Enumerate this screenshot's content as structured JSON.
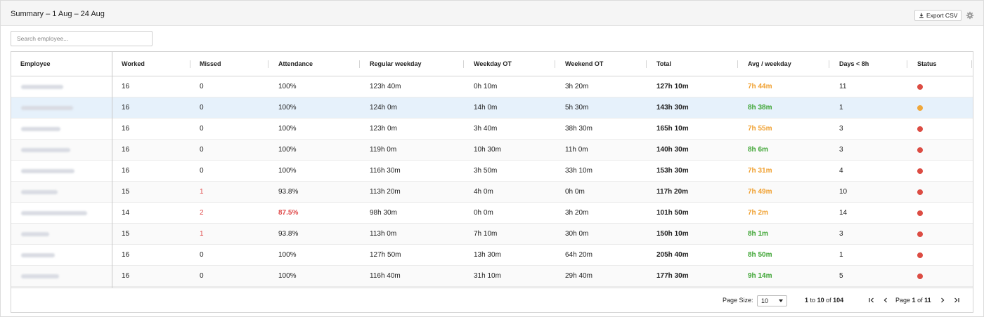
{
  "header": {
    "title": "Summary – 1 Aug – 24 Aug",
    "export_label": "Export CSV",
    "export_icon": "download-icon",
    "settings_icon": "gear-icon"
  },
  "search": {
    "placeholder": "Search employee...",
    "value": ""
  },
  "table": {
    "columns": [
      "Employee",
      "Worked",
      "Missed",
      "Attendance",
      "Regular weekday",
      "Weekday OT",
      "Weekend OT",
      "Total",
      "Avg / weekday",
      "Days < 8h",
      "Status"
    ],
    "rows": [
      {
        "worked": "16",
        "missed": "0",
        "attendance": "100%",
        "regular": "123h 40m",
        "weekday_ot": "0h 10m",
        "weekend_ot": "3h 20m",
        "total": "127h 10m",
        "avg": "7h 44m",
        "days_under": "11",
        "avg_tone": "warn",
        "status": "red"
      },
      {
        "worked": "16",
        "missed": "0",
        "attendance": "100%",
        "regular": "124h 0m",
        "weekday_ot": "14h 0m",
        "weekend_ot": "5h 30m",
        "total": "143h 30m",
        "avg": "8h 38m",
        "days_under": "1",
        "avg_tone": "ok",
        "status": "orange"
      },
      {
        "worked": "16",
        "missed": "0",
        "attendance": "100%",
        "regular": "123h 0m",
        "weekday_ot": "3h 40m",
        "weekend_ot": "38h 30m",
        "total": "165h 10m",
        "avg": "7h 55m",
        "days_under": "3",
        "avg_tone": "warn",
        "status": "red"
      },
      {
        "worked": "16",
        "missed": "0",
        "attendance": "100%",
        "regular": "119h 0m",
        "weekday_ot": "10h 30m",
        "weekend_ot": "11h 0m",
        "total": "140h 30m",
        "avg": "8h 6m",
        "days_under": "3",
        "avg_tone": "ok",
        "status": "red"
      },
      {
        "worked": "16",
        "missed": "0",
        "attendance": "100%",
        "regular": "116h 30m",
        "weekday_ot": "3h 50m",
        "weekend_ot": "33h 10m",
        "total": "153h 30m",
        "avg": "7h 31m",
        "days_under": "4",
        "avg_tone": "warn",
        "status": "red"
      },
      {
        "worked": "15",
        "missed": "1",
        "attendance": "93.8%",
        "regular": "113h 20m",
        "weekday_ot": "4h 0m",
        "weekend_ot": "0h 0m",
        "total": "117h 20m",
        "avg": "7h 49m",
        "days_under": "10",
        "avg_tone": "warn",
        "status": "red"
      },
      {
        "worked": "14",
        "missed": "2",
        "attendance": "87.5%",
        "regular": "98h 30m",
        "weekday_ot": "0h 0m",
        "weekend_ot": "3h 20m",
        "total": "101h 50m",
        "avg": "7h 2m",
        "days_under": "14",
        "avg_tone": "warn",
        "status": "red",
        "attendance_low": true
      },
      {
        "worked": "15",
        "missed": "1",
        "attendance": "93.8%",
        "regular": "113h 0m",
        "weekday_ot": "7h 10m",
        "weekend_ot": "30h 0m",
        "total": "150h 10m",
        "avg": "8h 1m",
        "days_under": "3",
        "avg_tone": "ok",
        "status": "red"
      },
      {
        "worked": "16",
        "missed": "0",
        "attendance": "100%",
        "regular": "127h 50m",
        "weekday_ot": "13h 30m",
        "weekend_ot": "64h 20m",
        "total": "205h 40m",
        "avg": "8h 50m",
        "days_under": "1",
        "avg_tone": "ok",
        "status": "red"
      },
      {
        "worked": "16",
        "missed": "0",
        "attendance": "100%",
        "regular": "116h 40m",
        "weekday_ot": "31h 10m",
        "weekend_ot": "29h 40m",
        "total": "177h 30m",
        "avg": "9h 14m",
        "days_under": "5",
        "avg_tone": "ok",
        "status": "red"
      }
    ],
    "selected_row": 1
  },
  "pagination": {
    "page_size_label": "Page Size:",
    "page_size": "10",
    "range_from": "1",
    "range_to_label": "to",
    "range_to": "10",
    "of_label": "of",
    "total_rows": "104",
    "page_label": "Page",
    "current_page": "1",
    "page_of_label": "of",
    "total_pages": "11",
    "icons": [
      "first-page-icon",
      "prev-page-icon",
      "next-page-icon",
      "last-page-icon"
    ]
  },
  "colors": {
    "ok": "#3fa535",
    "warn": "#f0a030",
    "danger": "#e04b4b",
    "status_red": "#dc4c43",
    "status_orange": "#f0a73a",
    "selected_row": "#e6f1fb"
  }
}
